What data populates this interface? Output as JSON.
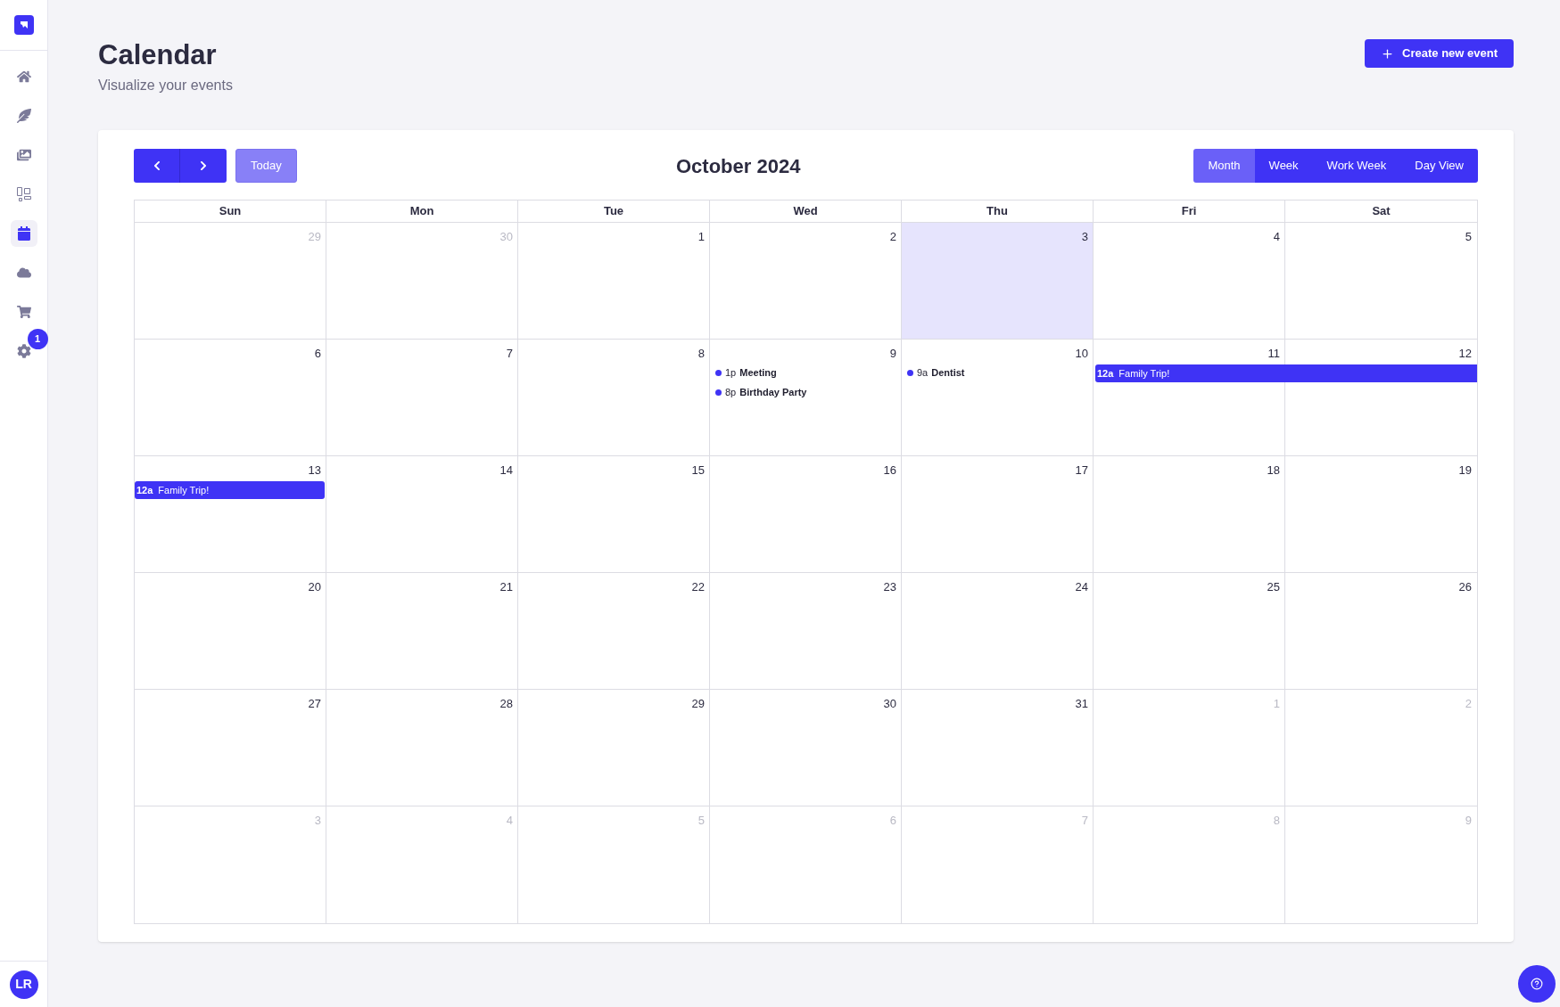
{
  "sidebar": {
    "items": [
      {
        "kind": "home",
        "selected": false
      },
      {
        "kind": "feather",
        "selected": false
      },
      {
        "kind": "images",
        "selected": false
      },
      {
        "kind": "layout",
        "selected": false
      },
      {
        "kind": "calendar",
        "selected": true
      },
      {
        "kind": "cloud",
        "selected": false
      },
      {
        "kind": "cart",
        "selected": false
      },
      {
        "kind": "settings",
        "selected": false,
        "badge": "1"
      }
    ],
    "avatar": "LR"
  },
  "header": {
    "title": "Calendar",
    "subtitle": "Visualize your events",
    "create_button": "Create new event"
  },
  "toolbar": {
    "today_button": "Today",
    "month_title": "October 2024",
    "views": [
      {
        "label": "Month",
        "selected": true
      },
      {
        "label": "Week",
        "selected": false
      },
      {
        "label": "Work Week",
        "selected": false
      },
      {
        "label": "Day View",
        "selected": false
      }
    ]
  },
  "weekdays": [
    "Sun",
    "Mon",
    "Tue",
    "Wed",
    "Thu",
    "Fri",
    "Sat"
  ],
  "weeks": [
    {
      "days": [
        {
          "day": "29",
          "muted": true,
          "today": false
        },
        {
          "day": "30",
          "muted": true,
          "today": false
        },
        {
          "day": "1",
          "muted": false,
          "today": false
        },
        {
          "day": "2",
          "muted": false,
          "today": false
        },
        {
          "day": "3",
          "muted": false,
          "today": true
        },
        {
          "day": "4",
          "muted": false,
          "today": false
        },
        {
          "day": "5",
          "muted": false,
          "today": false
        }
      ]
    },
    {
      "days": [
        {
          "day": "6",
          "muted": false,
          "today": false
        },
        {
          "day": "7",
          "muted": false,
          "today": false
        },
        {
          "day": "8",
          "muted": false,
          "today": false
        },
        {
          "day": "9",
          "muted": false,
          "today": false,
          "events": [
            {
              "kind": "dot",
              "time": "1p",
              "title": "Meeting",
              "color": "#3f33f5"
            },
            {
              "kind": "dot",
              "time": "8p",
              "title": "Birthday Party",
              "color": "#3f33f5"
            }
          ]
        },
        {
          "day": "10",
          "muted": false,
          "today": false,
          "events": [
            {
              "kind": "dot",
              "time": "9a",
              "title": "Dentist",
              "color": "#3f33f5"
            }
          ]
        },
        {
          "day": "11",
          "muted": false,
          "today": false,
          "events": [
            {
              "kind": "bar",
              "time": "12a",
              "title": "Family Trip!",
              "color": "#3f33f5",
              "continues_to_week_end": true
            }
          ]
        },
        {
          "day": "12",
          "muted": false,
          "today": false
        }
      ]
    },
    {
      "days": [
        {
          "day": "13",
          "muted": false,
          "today": false,
          "events": [
            {
              "kind": "bar",
              "time": "12a",
              "title": "Family Trip!",
              "color": "#3f33f5",
              "continues_to_week_end": false
            }
          ]
        },
        {
          "day": "14",
          "muted": false,
          "today": false
        },
        {
          "day": "15",
          "muted": false,
          "today": false
        },
        {
          "day": "16",
          "muted": false,
          "today": false
        },
        {
          "day": "17",
          "muted": false,
          "today": false
        },
        {
          "day": "18",
          "muted": false,
          "today": false
        },
        {
          "day": "19",
          "muted": false,
          "today": false
        }
      ]
    },
    {
      "days": [
        {
          "day": "20",
          "muted": false,
          "today": false
        },
        {
          "day": "21",
          "muted": false,
          "today": false
        },
        {
          "day": "22",
          "muted": false,
          "today": false
        },
        {
          "day": "23",
          "muted": false,
          "today": false
        },
        {
          "day": "24",
          "muted": false,
          "today": false
        },
        {
          "day": "25",
          "muted": false,
          "today": false
        },
        {
          "day": "26",
          "muted": false,
          "today": false
        }
      ]
    },
    {
      "days": [
        {
          "day": "27",
          "muted": false,
          "today": false
        },
        {
          "day": "28",
          "muted": false,
          "today": false
        },
        {
          "day": "29",
          "muted": false,
          "today": false
        },
        {
          "day": "30",
          "muted": false,
          "today": false
        },
        {
          "day": "31",
          "muted": false,
          "today": false
        },
        {
          "day": "1",
          "muted": true,
          "today": false
        },
        {
          "day": "2",
          "muted": true,
          "today": false
        }
      ]
    },
    {
      "days": [
        {
          "day": "3",
          "muted": true,
          "today": false
        },
        {
          "day": "4",
          "muted": true,
          "today": false
        },
        {
          "day": "5",
          "muted": true,
          "today": false
        },
        {
          "day": "6",
          "muted": true,
          "today": false
        },
        {
          "day": "7",
          "muted": true,
          "today": false
        },
        {
          "day": "8",
          "muted": true,
          "today": false
        },
        {
          "day": "9",
          "muted": true,
          "today": false
        }
      ]
    }
  ]
}
